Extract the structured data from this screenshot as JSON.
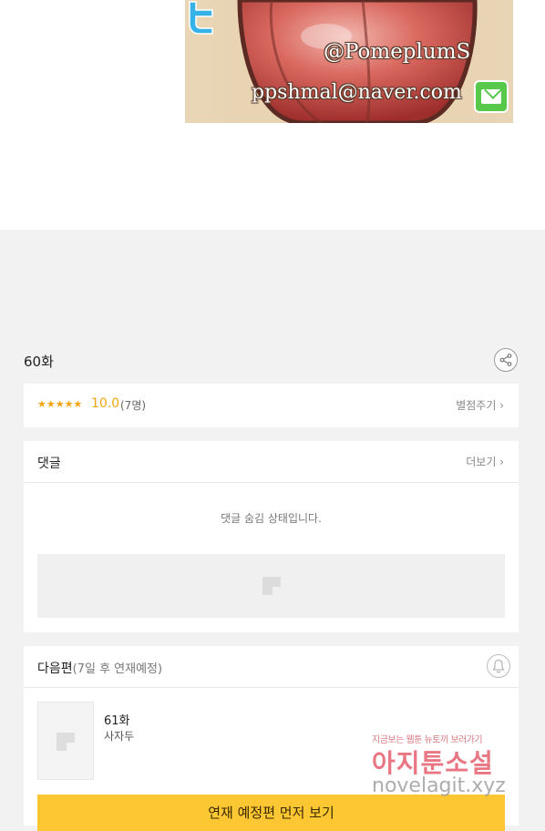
{
  "banner": {
    "handle": "@PomeplumS",
    "email": "ppshmal@naver.com",
    "icons": [
      "twitter-icon",
      "mail-icon"
    ]
  },
  "episode": {
    "title": "60화",
    "share_icon": "share-icon"
  },
  "rating": {
    "stars": "★★★★★",
    "score": "10.0",
    "count": "(7명)",
    "rate_link": "별점주기 ›"
  },
  "comments": {
    "title": "댓글",
    "more": "더보기 ›",
    "hidden_message": "댓글 숨김 상태입니다."
  },
  "next": {
    "title": "다음편",
    "subtitle": "(7일 후 연재예정)",
    "episode": "61화",
    "author": "사자두",
    "cta": "연재 예정편 먼저 보기",
    "bell_icon": "bell-icon"
  },
  "watermark": {
    "line1": "지금보는 웹툰 뉴토끼 보러가기",
    "line2": "아지툰소설",
    "url": "novelagit.xyz"
  },
  "colors": {
    "accent": "#fcc733",
    "star": "#f2a413",
    "background": "#f2f2f2"
  }
}
